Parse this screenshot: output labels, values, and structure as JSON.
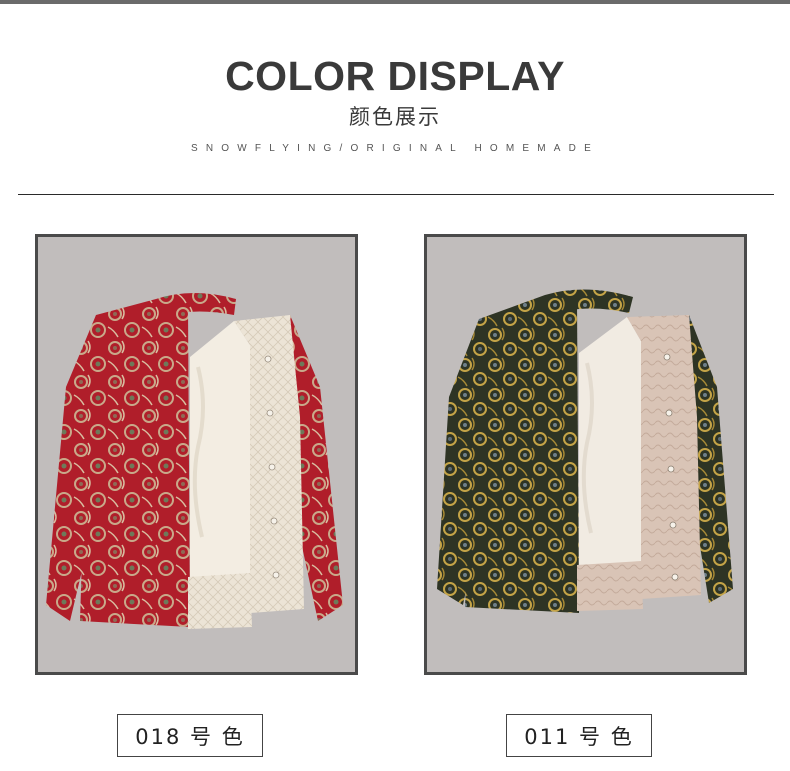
{
  "header": {
    "title": "COLOR DISPLAY",
    "subtitle": "颜色展示",
    "tagline": "SNOWFLYING/ORIGINAL HOMEMADE"
  },
  "products": [
    {
      "label": "018 号 色",
      "fabric_color": "#b01e2a",
      "pattern_color": "#c9a98a",
      "lining_color": "#f2ece0"
    },
    {
      "label": "011 号 色",
      "fabric_color": "#2e3424",
      "pattern_color": "#c4a447",
      "lining_color": "#e2cfc1"
    }
  ]
}
